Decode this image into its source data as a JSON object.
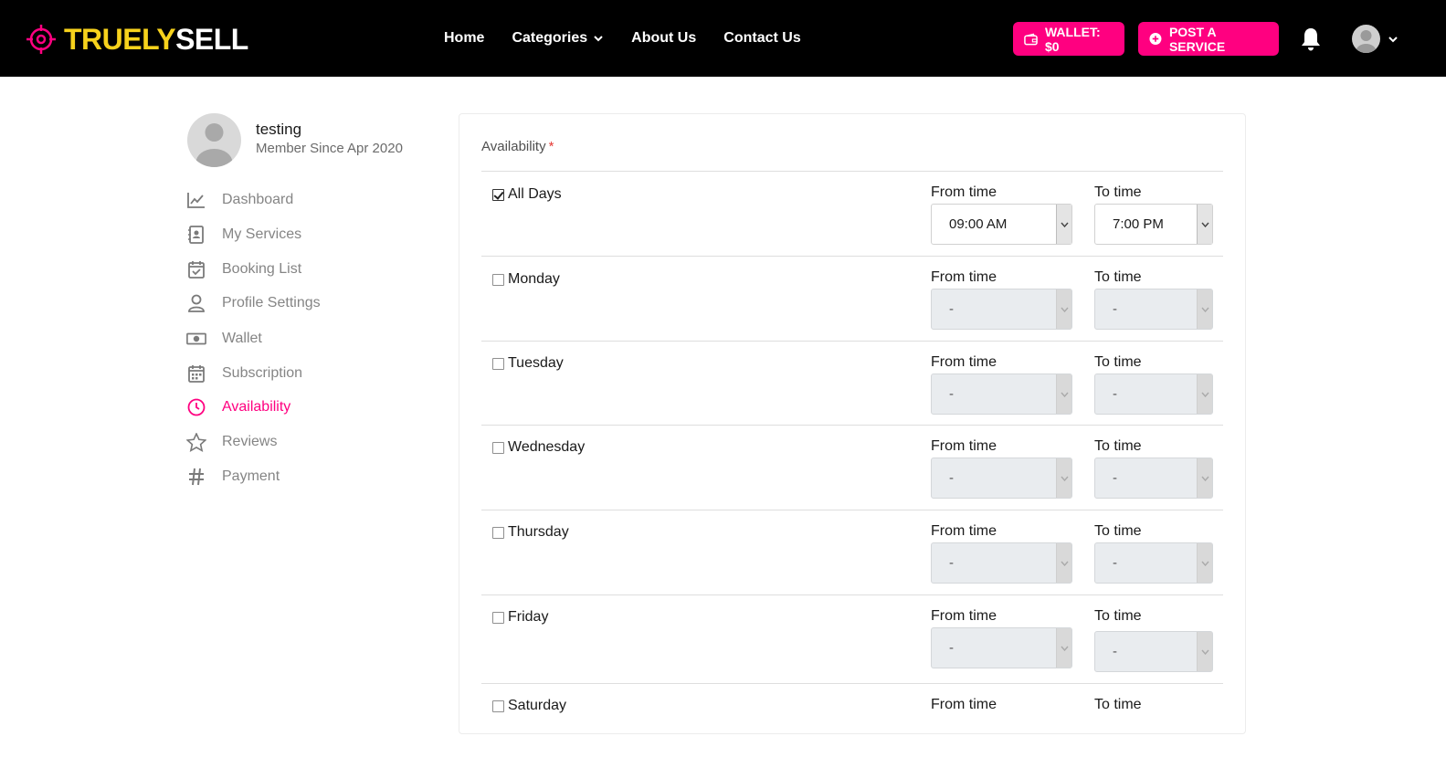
{
  "brand": {
    "part1": "TRUELY",
    "part2": "SELL",
    "accent": "#ff0080",
    "logo_yellow": "#f7d21c"
  },
  "nav": {
    "home": "Home",
    "categories": "Categories",
    "about": "About Us",
    "contact": "Contact Us"
  },
  "header_actions": {
    "wallet": "WALLET: $0",
    "post": "POST A SERVICE"
  },
  "profile": {
    "name": "testing",
    "since": "Member Since Apr 2020"
  },
  "sidebar": {
    "items": [
      {
        "label": "Dashboard",
        "icon": "chart-icon"
      },
      {
        "label": "My Services",
        "icon": "contact-card-icon"
      },
      {
        "label": "Booking List",
        "icon": "calendar-check-icon"
      },
      {
        "label": "Profile Settings",
        "icon": "user-icon"
      },
      {
        "label": "Wallet",
        "icon": "money-icon"
      },
      {
        "label": "Subscription",
        "icon": "calendar-icon"
      },
      {
        "label": "Availability",
        "icon": "clock-icon",
        "active": true
      },
      {
        "label": "Reviews",
        "icon": "star-icon"
      },
      {
        "label": "Payment",
        "icon": "hash-icon"
      }
    ]
  },
  "availability": {
    "title": "Availability",
    "required_mark": "*",
    "from_label": "From time",
    "to_label": "To time",
    "days": [
      {
        "label": "All Days",
        "checked": true,
        "from": "09:00 AM",
        "to": "7:00 PM",
        "enabled": true
      },
      {
        "label": "Monday",
        "checked": false,
        "from": "-",
        "to": "-",
        "enabled": false
      },
      {
        "label": "Tuesday",
        "checked": false,
        "from": "-",
        "to": "-",
        "enabled": false
      },
      {
        "label": "Wednesday",
        "checked": false,
        "from": "-",
        "to": "-",
        "enabled": false
      },
      {
        "label": "Thursday",
        "checked": false,
        "from": "-",
        "to": "-",
        "enabled": false
      },
      {
        "label": "Friday",
        "checked": false,
        "from": "-",
        "to": "-",
        "enabled": false
      },
      {
        "label": "Saturday",
        "checked": false,
        "from": "",
        "to": "",
        "enabled": false
      }
    ]
  }
}
